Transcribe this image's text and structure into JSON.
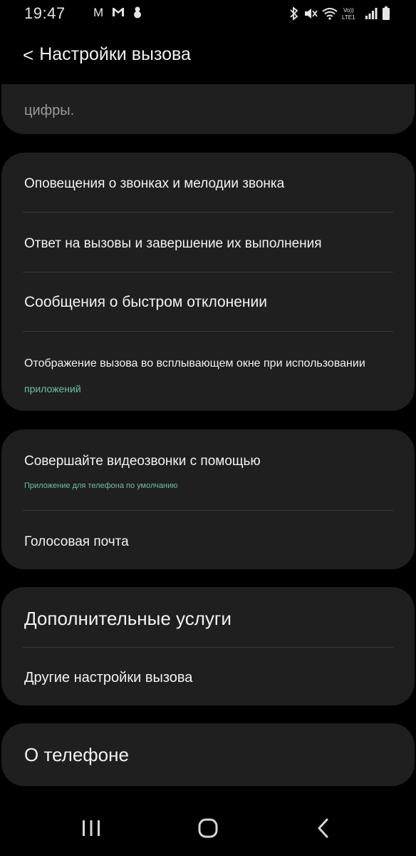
{
  "status_bar": {
    "time": "19:47",
    "left_icons": [
      "m-letter-icon",
      "gmail-icon",
      "snowman-icon"
    ],
    "right_icons": [
      "bluetooth-icon",
      "mute-icon",
      "wifi-icon",
      "volte-lte-icon",
      "signal-icon",
      "battery-icon"
    ],
    "carrier_letter": "M",
    "volte_label": "Vo)) LTE1"
  },
  "header": {
    "back_symbol": "<",
    "title": "Настройки вызова"
  },
  "partial_item": {
    "text": "цифры."
  },
  "group1": {
    "items": [
      {
        "title": "Оповещения о звонках и мелодии звонка"
      },
      {
        "title": "Ответ на вызовы и завершение их выполнения"
      },
      {
        "title": "Сообщения о быстром отклонении"
      },
      {
        "title": "Отображение вызова во всплывающем окне при использовании",
        "subtitle": "приложений"
      }
    ]
  },
  "group2": {
    "items": [
      {
        "title": "Совершайте видеозвонки с помощью",
        "subtitle": "Приложение для телефона по умолчанию"
      },
      {
        "title": "Голосовая почта"
      }
    ]
  },
  "group3": {
    "items": [
      {
        "title": "Дополнительные услуги"
      },
      {
        "title": "Другие настройки вызова"
      }
    ]
  },
  "group4": {
    "items": [
      {
        "title": "О телефоне"
      }
    ]
  },
  "colors": {
    "background": "#000000",
    "card": "#1f1f1f",
    "accent_sub": "#6fbfa8",
    "divider": "#3a3a3a"
  }
}
